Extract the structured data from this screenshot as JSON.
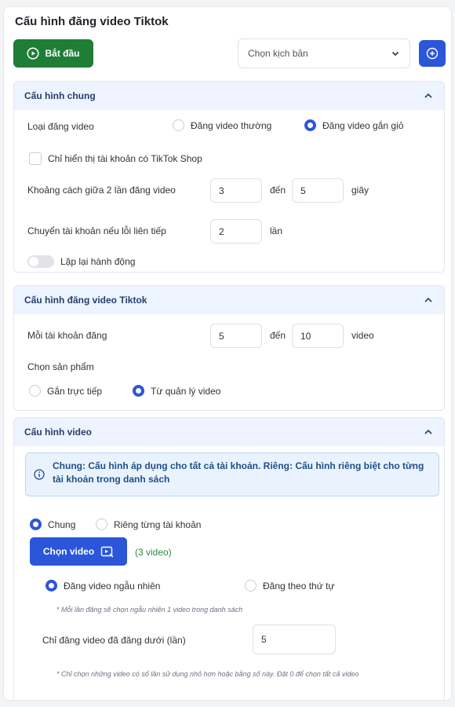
{
  "page": {
    "title": "Cấu hình đăng video Tiktok"
  },
  "toolbar": {
    "start_label": "Bắt đầu",
    "scenario_select": "Chọn kịch bản"
  },
  "general": {
    "title": "Cấu hình chung",
    "post_type_label": "Loại đăng video",
    "post_type_options": [
      "Đăng video thường",
      "Đăng video gắn giỏ"
    ],
    "post_type_selected": "Đăng video gắn giỏ",
    "shop_only_label": "Chỉ hiển thị tài khoản có TikTok Shop",
    "interval_label": "Khoảng cách giữa 2 lần đăng video",
    "interval_from": "3",
    "to_word": "đến",
    "interval_to": "5",
    "interval_unit": "giây",
    "switch_label": "Chuyển tài khoản nếu lỗi liên tiếp",
    "switch_value": "2",
    "switch_unit": "lần",
    "repeat_label": "Lặp lại hành động"
  },
  "tiktok": {
    "title": "Cấu hình đăng video Tiktok",
    "per_account_label": "Mỗi tài khoản đăng",
    "per_from": "5",
    "to_word": "đến",
    "per_to": "10",
    "per_unit": "video",
    "product_label": "Chọn sản phẩm",
    "product_options": [
      "Gắn trực tiếp",
      "Từ quản lý video"
    ],
    "product_selected": "Từ quản lý video"
  },
  "video": {
    "title": "Cấu hình video",
    "info_text": "Chung: Cấu hình áp dụng cho tất cả tài khoản. Riêng: Cấu hình riêng biệt cho từng tài khoản trong danh sách",
    "scope_options": [
      "Chung",
      "Riêng từng tài khoản"
    ],
    "scope_selected": "Chung",
    "choose_label": "Chọn video",
    "video_count": "(3 video)",
    "order_options": [
      "Đăng video ngẫu nhiên",
      "Đăng theo thứ tự"
    ],
    "order_selected": "Đăng video ngẫu nhiên",
    "random_note": "* Mỗi lần đăng sẽ chọn ngẫu nhiên 1 video trong danh sách",
    "max_used_label": "Chỉ đăng video đã đăng dưới (lần)",
    "max_used_value": "5",
    "max_used_note": "* Chỉ chọn những video có số lần sử dụng nhỏ hơn hoặc bằng số này. Đặt 0 để chọn tất cả video"
  },
  "colors": {
    "primary": "#2b56d9",
    "start": "#1f7d36",
    "section_head": "#edf3ff"
  }
}
